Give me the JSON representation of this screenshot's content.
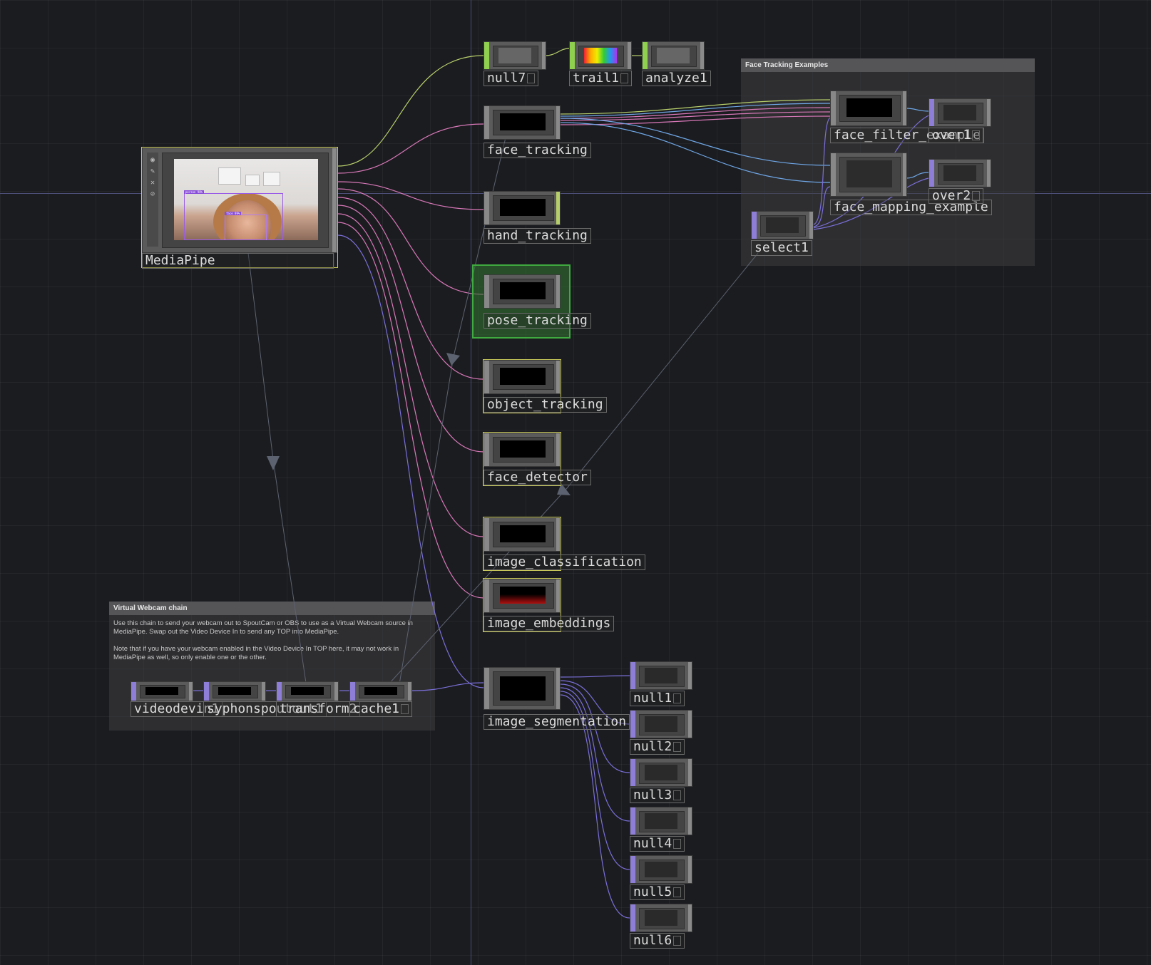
{
  "annotations": {
    "face_tracking_examples": {
      "title": "Face Tracking Examples"
    },
    "virtual_webcam": {
      "title": "Virtual Webcam chain",
      "body": "Use this chain to send your webcam out to SpoutCam or OBS to use as a Virtual Webcam source in MediaPipe. Swap out the Video Device In to send any TOP into MediaPipe.\n\nNote that if you have your webcam enabled in the Video Device In TOP here, it may not work in MediaPipe as well, so only enable one or the other."
    }
  },
  "nodes": {
    "mediapipe": "MediaPipe",
    "null7": "null7",
    "trail1": "trail1",
    "analyze1": "analyze1",
    "face_tracking": "face_tracking",
    "hand_tracking": "hand_tracking",
    "pose_tracking": "pose_tracking",
    "object_tracking": "object_tracking",
    "face_detector": "face_detector",
    "image_classification": "image_classification",
    "image_embeddings": "image_embeddings",
    "image_segmentation": "image_segmentation",
    "face_filter_example": "face_filter_example",
    "over1": "over1",
    "face_mapping_example": "face_mapping_example",
    "over2": "over2",
    "select1": "select1",
    "videodevin1": "videodevin1",
    "syphonspoutout1": "syphonspoutout1",
    "transform2": "transform2",
    "cache1": "cache1",
    "null1": "null1",
    "null2": "null2",
    "null3": "null3",
    "null4": "null4",
    "null5": "null5",
    "null6": "null6"
  },
  "colors": {
    "background": "#1b1c20",
    "chop_strip": "#8fd14f",
    "top_strip": "#8f7ed8",
    "selected_outline": "#c9c95a",
    "current_outline": "#3faa3f",
    "wire_chop": "#b7cf6a",
    "wire_pink": "#d878b8",
    "wire_blue": "#6fa7e6",
    "wire_purple": "#7a6fd8",
    "wire_dependency": "#5c6270"
  },
  "icons": [
    "record-icon",
    "pencil-icon",
    "close-icon",
    "link-icon",
    "triangle-arrow-icon"
  ]
}
